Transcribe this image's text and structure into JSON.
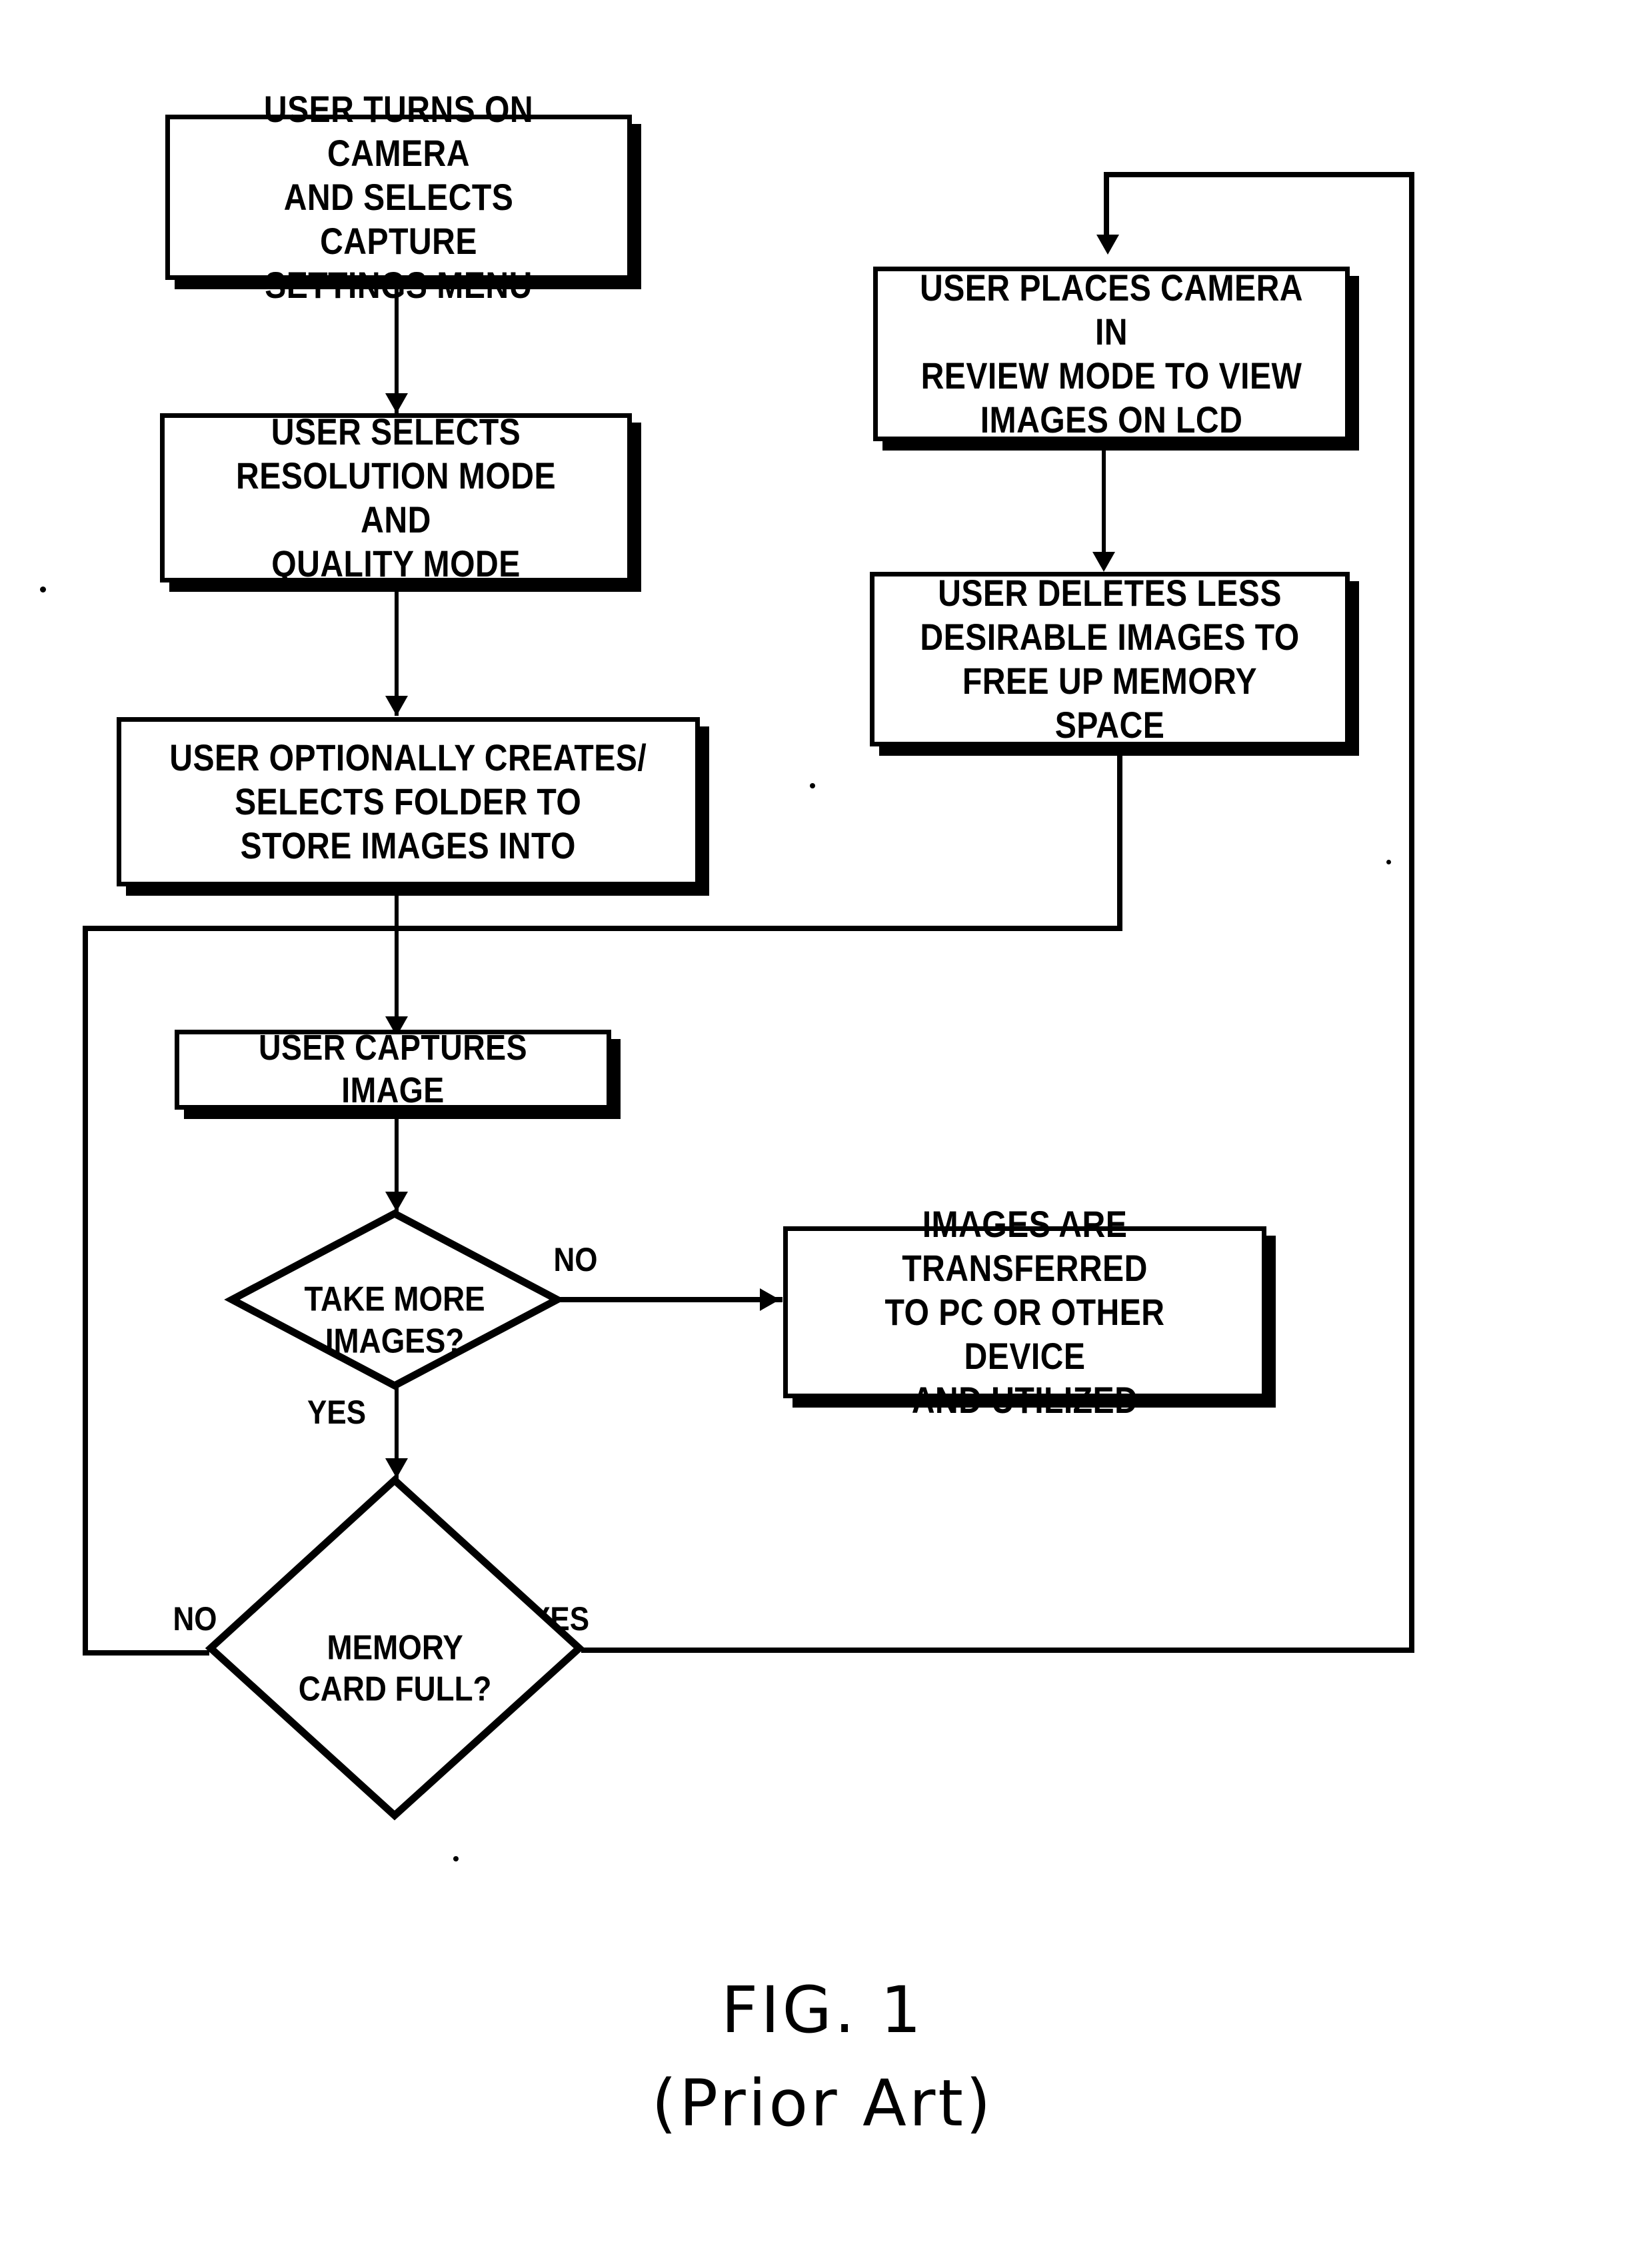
{
  "figure": {
    "caption_line1": "FIG. 1",
    "caption_line2": "(Prior Art)",
    "type": "flowchart",
    "ink_color": "#000000",
    "background_color": "#ffffff"
  },
  "nodes": {
    "turn_on_camera": {
      "id": "turn_on_camera",
      "shape": "process",
      "text": "USER TURNS ON CAMERA\nAND SELECTS CAPTURE\nSETTINGS MENU"
    },
    "select_resolution": {
      "id": "select_resolution",
      "shape": "process",
      "text": "USER SELECTS\nRESOLUTION MODE AND\nQUALITY MODE"
    },
    "create_folder": {
      "id": "create_folder",
      "shape": "process",
      "text": "USER OPTIONALLY CREATES/\nSELECTS FOLDER TO\nSTORE IMAGES INTO"
    },
    "capture_image": {
      "id": "capture_image",
      "shape": "process",
      "text": "USER CAPTURES IMAGE"
    },
    "review_mode": {
      "id": "review_mode",
      "shape": "process",
      "text": "USER PLACES CAMERA IN\nREVIEW MODE TO VIEW\nIMAGES ON LCD"
    },
    "delete_images": {
      "id": "delete_images",
      "shape": "process",
      "text": "USER DELETES LESS\nDESIRABLE IMAGES TO\nFREE UP MEMORY SPACE"
    },
    "transfer_images": {
      "id": "transfer_images",
      "shape": "process",
      "text": "IMAGES ARE TRANSFERRED\nTO PC OR OTHER DEVICE\nAND UTILIZED"
    },
    "take_more": {
      "id": "take_more",
      "shape": "decision",
      "text": "TAKE MORE\nIMAGES?"
    },
    "memory_full": {
      "id": "memory_full",
      "shape": "decision",
      "text": "MEMORY\nCARD FULL?"
    }
  },
  "branch_labels": {
    "take_more_no": "NO",
    "take_more_yes": "YES",
    "memory_full_no": "NO",
    "memory_full_yes": "YES"
  },
  "edges": [
    {
      "from": "turn_on_camera",
      "to": "select_resolution",
      "label": ""
    },
    {
      "from": "select_resolution",
      "to": "create_folder",
      "label": ""
    },
    {
      "from": "create_folder",
      "to": "capture_image",
      "label": ""
    },
    {
      "from": "capture_image",
      "to": "take_more",
      "label": ""
    },
    {
      "from": "take_more",
      "to": "transfer_images",
      "label": "NO"
    },
    {
      "from": "take_more",
      "to": "memory_full",
      "label": "YES"
    },
    {
      "from": "memory_full",
      "to": "capture_image",
      "label": "NO"
    },
    {
      "from": "memory_full",
      "to": "review_mode",
      "label": "YES"
    },
    {
      "from": "review_mode",
      "to": "delete_images",
      "label": ""
    },
    {
      "from": "delete_images",
      "to": "capture_image",
      "label": ""
    }
  ]
}
